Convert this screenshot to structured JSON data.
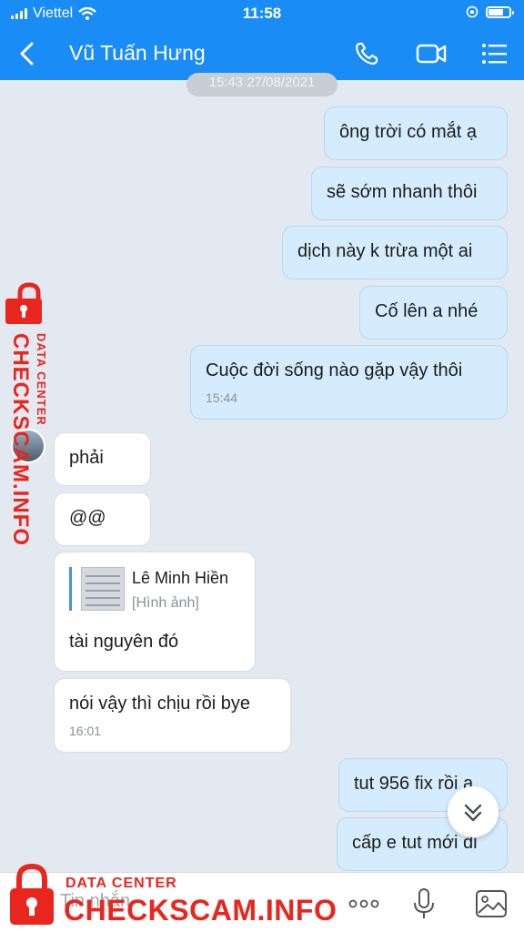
{
  "status_bar": {
    "carrier": "Viettel",
    "time": "11:58"
  },
  "header": {
    "contact_name": "Vũ Tuấn Hưng"
  },
  "chat": {
    "date_separator": "15:43 27/08/2021",
    "messages": [
      {
        "dir": "out",
        "text": "ông trời có mắt ạ"
      },
      {
        "dir": "out",
        "text": "sẽ sớm nhanh thôi"
      },
      {
        "dir": "out",
        "text": "dịch này k trừa một ai"
      },
      {
        "dir": "out",
        "text": "Cố lên a nhé"
      },
      {
        "dir": "out",
        "text": "Cuộc đời sống nào gặp vậy thôi",
        "time": "15:44"
      },
      {
        "dir": "in",
        "text": "phải"
      },
      {
        "dir": "in",
        "text": "@@"
      },
      {
        "dir": "in",
        "text": "tài nguyên đó",
        "quote": {
          "name": "Lê Minh Hiền",
          "subtitle": "[Hình ảnh]"
        }
      },
      {
        "dir": "in",
        "text": "nói vậy thì chịu rồi bye",
        "time": "16:01"
      },
      {
        "dir": "out",
        "text": "tut 956 fix rồi a"
      },
      {
        "dir": "out",
        "text": "cấp e tut mới đi"
      }
    ]
  },
  "input_bar": {
    "placeholder": "Tin nhắn"
  },
  "watermark": {
    "brand": "CHECKSCAM.INFO",
    "tagline": "DATA CENTER",
    "color": "#e8261d"
  },
  "colors": {
    "header": "#1a8cf5",
    "outgoing_bubble": "#d4ecfd",
    "incoming_bubble": "#ffffff",
    "background": "#e2e9f1"
  }
}
